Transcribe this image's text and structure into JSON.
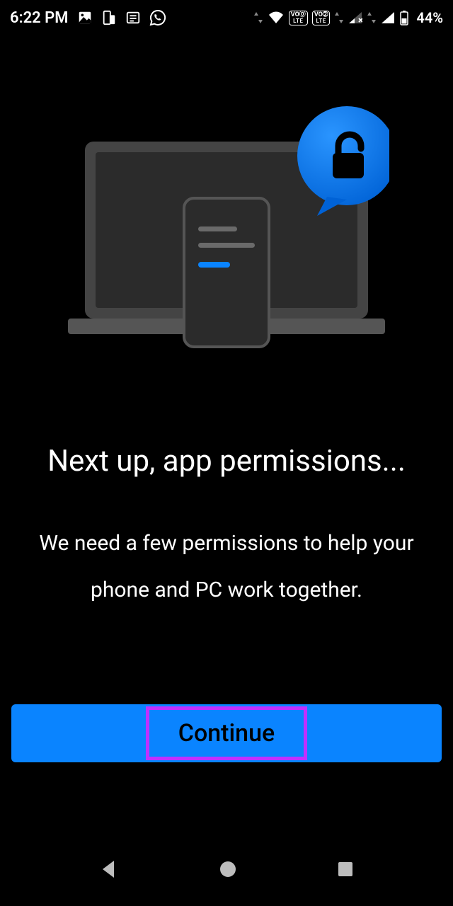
{
  "status": {
    "time": "6:22 PM",
    "battery_pct": "44%"
  },
  "screen": {
    "heading": "Next up, app permissions...",
    "subheading": "We need a few permissions to help your phone and PC work together."
  },
  "button": {
    "continue_label": "Continue"
  }
}
